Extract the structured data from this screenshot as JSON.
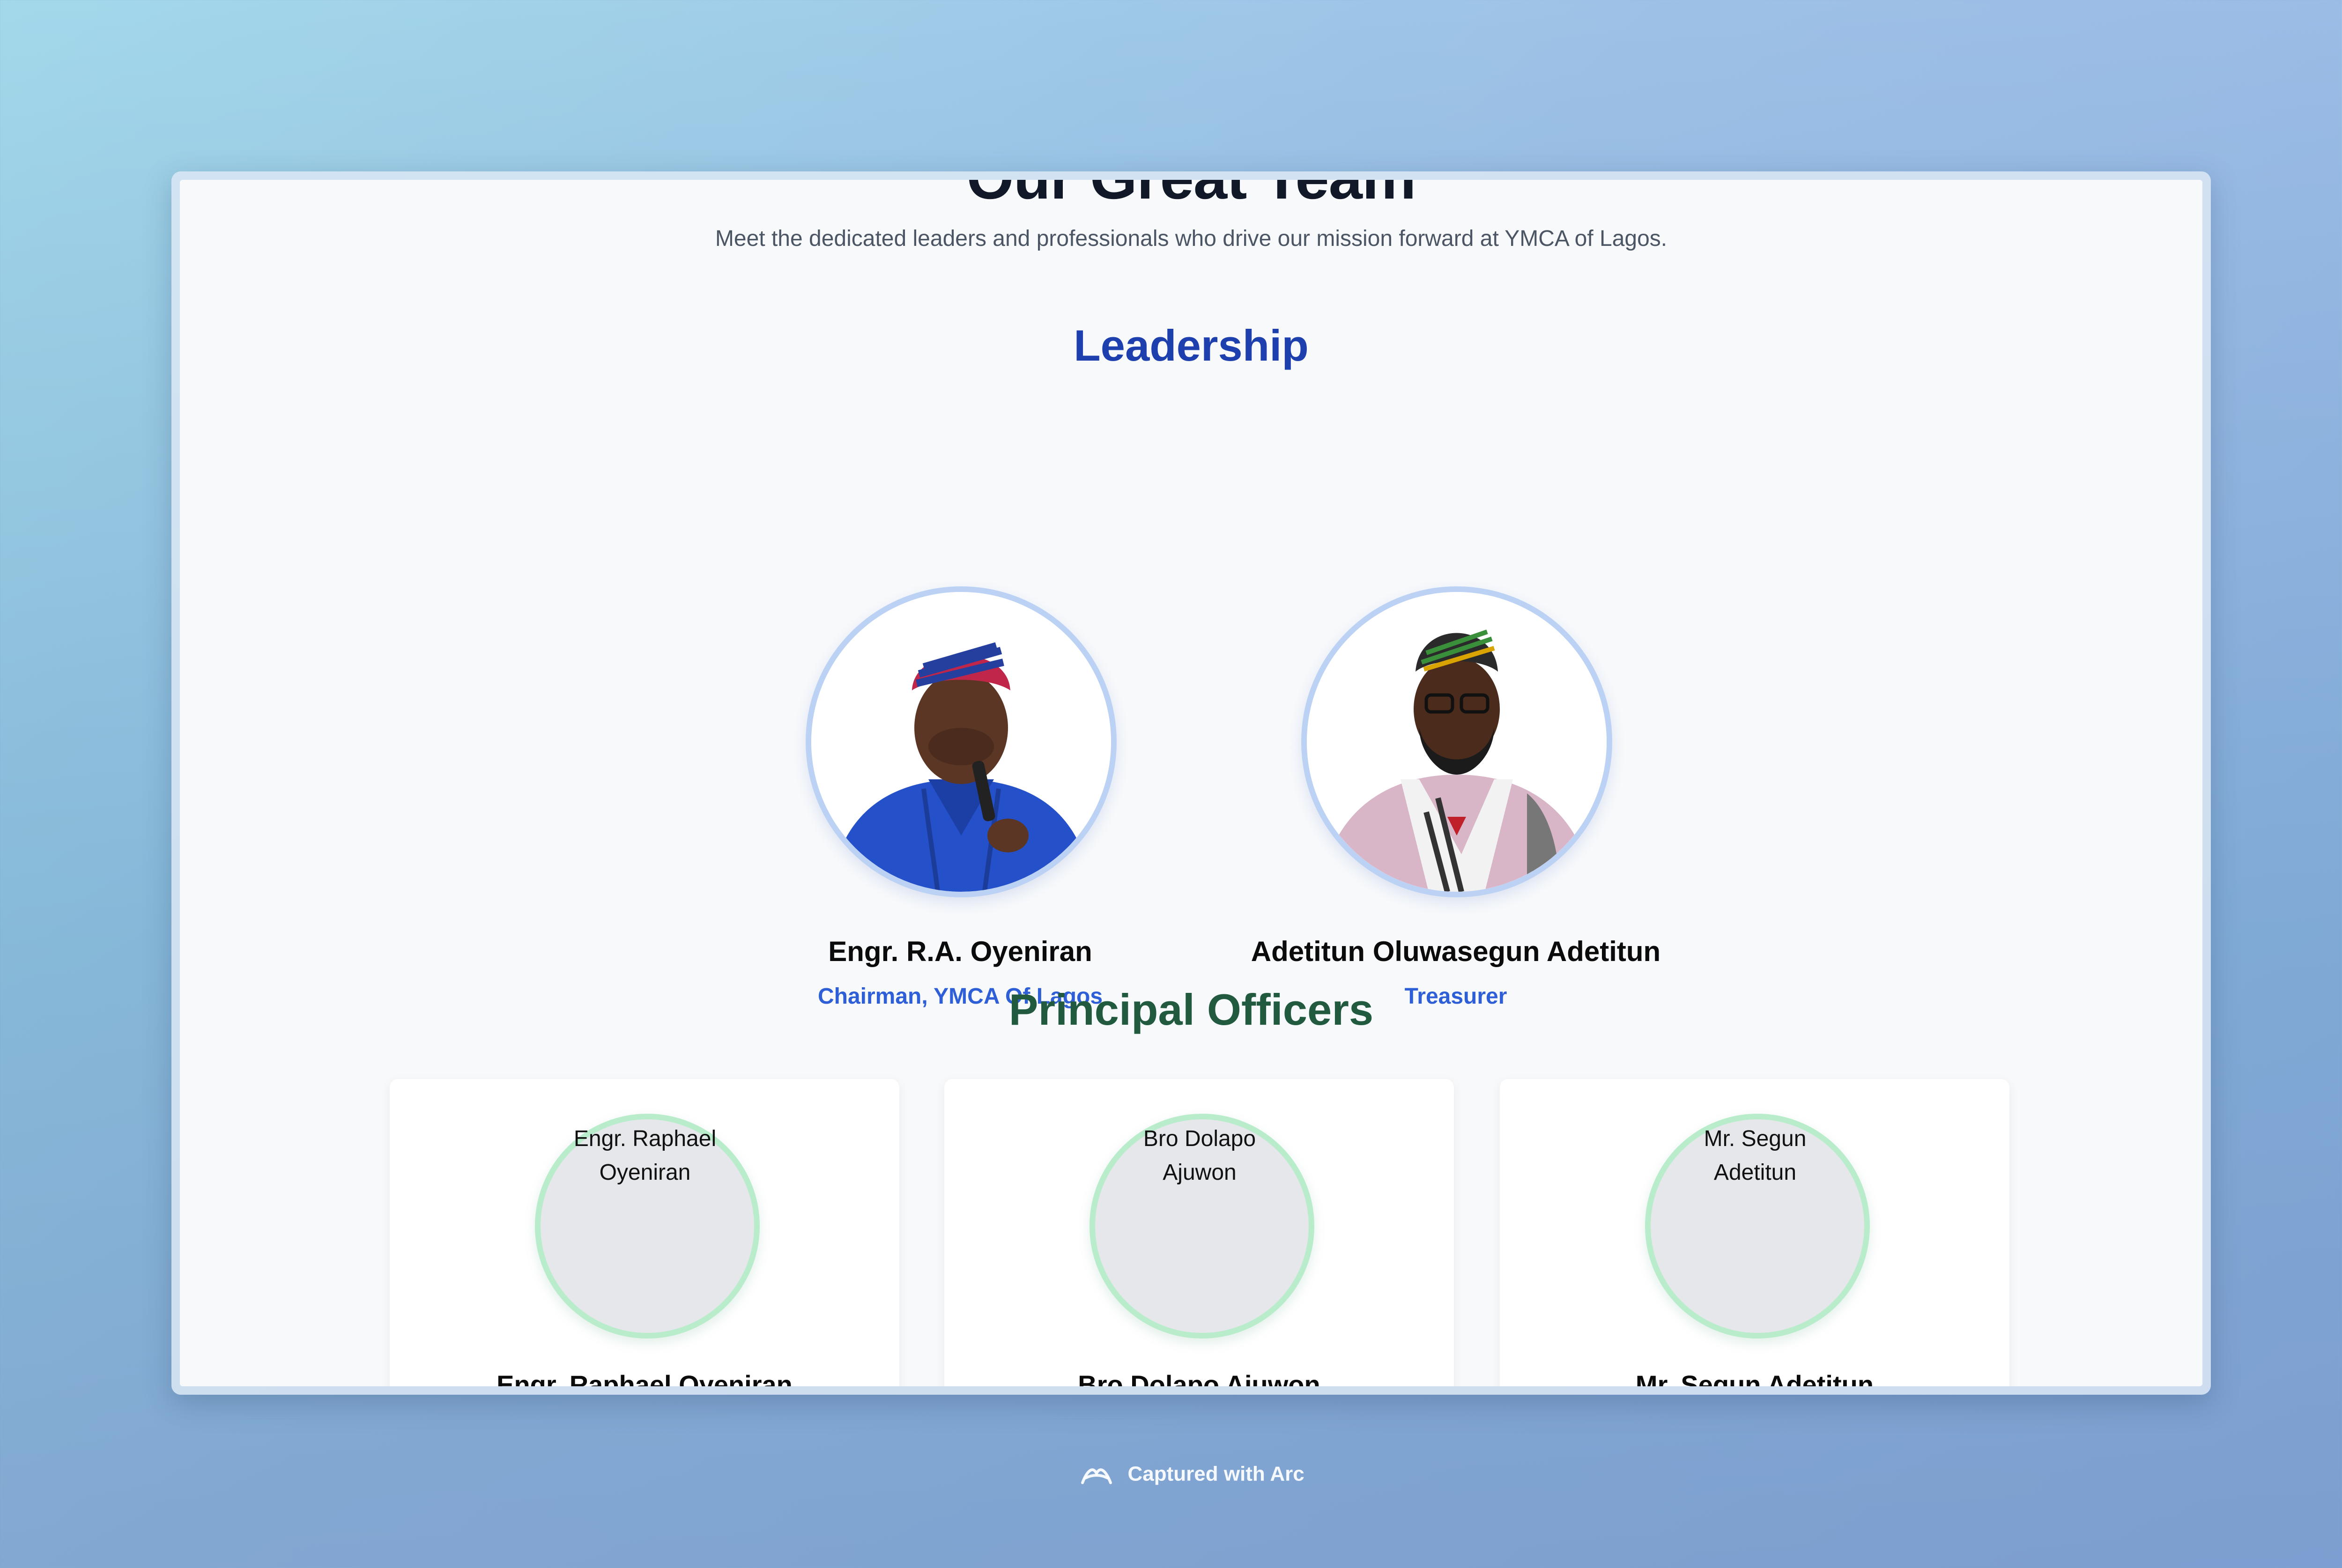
{
  "header": {
    "title_partial": "Our Great Team",
    "subtitle": "Meet the dedicated leaders and professionals who drive our mission forward at YMCA of Lagos."
  },
  "leadership": {
    "title": "Leadership",
    "members": [
      {
        "name": "Engr. R.A. Oyeniran",
        "role": "Chairman, YMCA Of Lagos",
        "photo_icon": "portrait-photo"
      },
      {
        "name": "Adetitun Oluwasegun Adetitun",
        "role": "Treasurer",
        "photo_icon": "portrait-photo"
      }
    ]
  },
  "officers": {
    "title": "Principal Officers",
    "members": [
      {
        "alt": "Engr. Raphael Oyeniran",
        "name": "Engr. Raphael Oyeniran"
      },
      {
        "alt": "Bro Dolapo Ajuwon",
        "name": "Bro Dolapo Ajuwon"
      },
      {
        "alt": "Mr. Segun Adetitun",
        "name": "Mr. Segun Adetitun"
      }
    ]
  },
  "caption": {
    "text": "Captured with Arc",
    "icon": "arc-logo-icon"
  },
  "colors": {
    "leadership_title": "#1e40af",
    "officers_title": "#215a3f",
    "role_text": "#2f5fd7",
    "leader_ring": "#bcd2f5",
    "officer_ring": "#b8eccb"
  }
}
